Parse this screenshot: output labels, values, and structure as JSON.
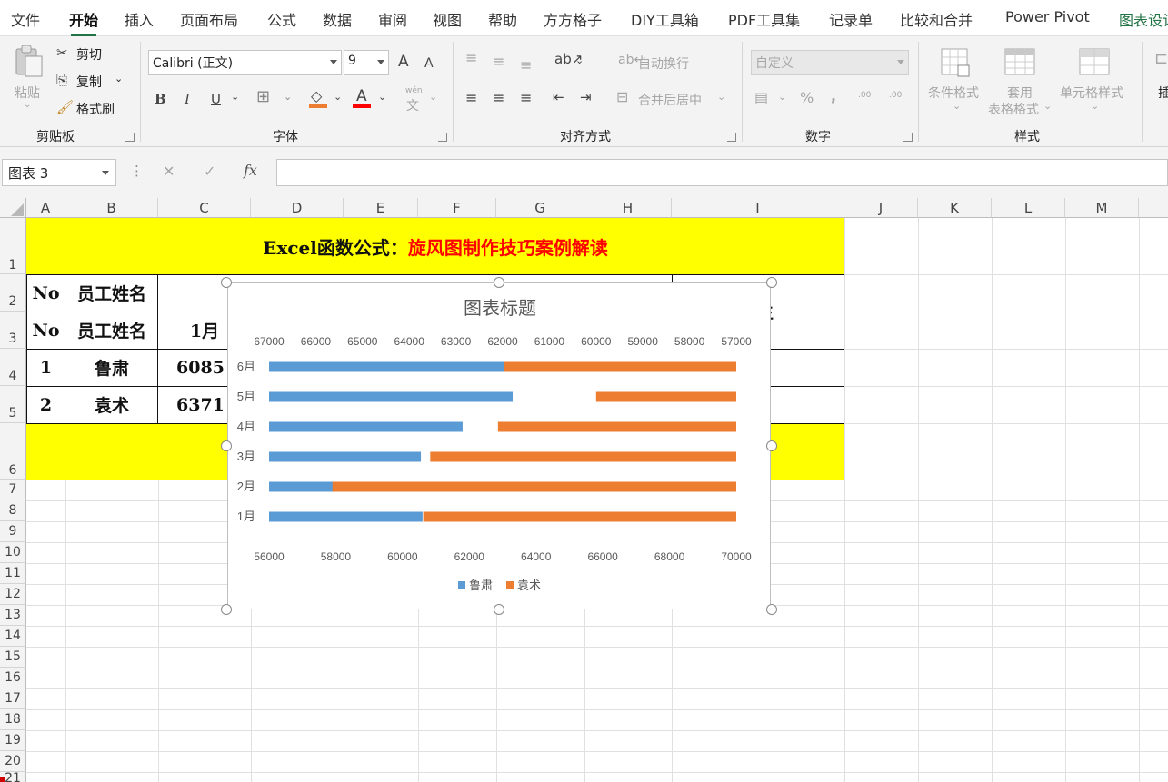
{
  "tabs": [
    "文件",
    "开始",
    "插入",
    "页面布局",
    "公式",
    "数据",
    "审阅",
    "视图",
    "帮助",
    "方方格子",
    "DIY工具箱",
    "PDF工具集",
    "记录单",
    "比较和合并",
    "Power Pivot",
    "图表设计"
  ],
  "ribbon": {
    "clipboard": {
      "paste": "粘贴",
      "cut": "剪切",
      "copy": "复制",
      "format_painter": "格式刷",
      "label": "剪贴板"
    },
    "font": {
      "name": "Calibri (正文)",
      "size": "9",
      "label": "字体",
      "bold": "B",
      "italic": "I",
      "underline": "U",
      "grow": "A",
      "shrink": "A",
      "font_color": "A",
      "wen": "wén",
      "wen_char": "文"
    },
    "alignment": {
      "wrap": "自动换行",
      "merge": "合并后居中",
      "label": "对齐方式"
    },
    "number": {
      "format": "自定义",
      "label": "数字",
      "percent": "%",
      "comma": ",",
      "inc_decimal": ".00",
      "dec_decimal": ".00"
    },
    "styles": {
      "conditional": "条件格式",
      "table1": "套用",
      "table2": "表格格式",
      "cell": "单元格样式",
      "label": "样式"
    },
    "insert_cut": "插"
  },
  "formula_bar": {
    "name_box": "图表 3",
    "fx": "fx",
    "cancel": "✕",
    "confirm": "✓",
    "value": ""
  },
  "columns": [
    "A",
    "B",
    "C",
    "D",
    "E",
    "F",
    "G",
    "H",
    "I",
    "J",
    "K",
    "L",
    "M"
  ],
  "rows": [
    "1",
    "2",
    "3",
    "4",
    "5",
    "6",
    "7",
    "8",
    "9",
    "10",
    "11",
    "12",
    "13",
    "14",
    "15",
    "16",
    "17",
    "18",
    "19",
    "20",
    "21"
  ],
  "sheet": {
    "title_black": "Excel函数公式：",
    "title_red": "旋风图制作技巧案例解读",
    "r2_no": "No",
    "r2_name": "员工姓名",
    "r2_i_partial": "生",
    "r3_no": "No",
    "r3_name": "员工姓名",
    "r3_c": "1月",
    "r4_no": "1",
    "r4_name": "鲁肃",
    "r4_c": "6085",
    "r5_no": "2",
    "r5_name": "袁术",
    "r5_c": "6371"
  },
  "colors": {
    "yellow": "#FFFF00",
    "red": "#FF0000",
    "blue": "#5B9BD5",
    "orange": "#ED7D31",
    "excel_green": "#217346"
  },
  "chart_data": {
    "type": "bar",
    "title": "图表标题",
    "categories": [
      "1月",
      "2月",
      "3月",
      "4月",
      "5月",
      "6月"
    ],
    "series": [
      {
        "name": "鲁肃",
        "axis": "bottom",
        "values": [
          60600,
          57900,
          60550,
          61800,
          63300,
          63050
        ]
      },
      {
        "name": "袁术",
        "axis": "top",
        "values": [
          63700,
          66700,
          63550,
          62100,
          60000,
          62050
        ]
      }
    ],
    "bottom_axis": {
      "min": 56000,
      "max": 70000,
      "ticks": [
        "56000",
        "58000",
        "60000",
        "62000",
        "64000",
        "66000",
        "68000",
        "70000"
      ]
    },
    "top_axis": {
      "min": 57000,
      "max": 67000,
      "reversed": true,
      "ticks": [
        "67000",
        "66000",
        "65000",
        "64000",
        "63000",
        "62000",
        "61000",
        "60000",
        "59000",
        "58000",
        "57000"
      ]
    },
    "legend": "bottom",
    "grid": false
  }
}
